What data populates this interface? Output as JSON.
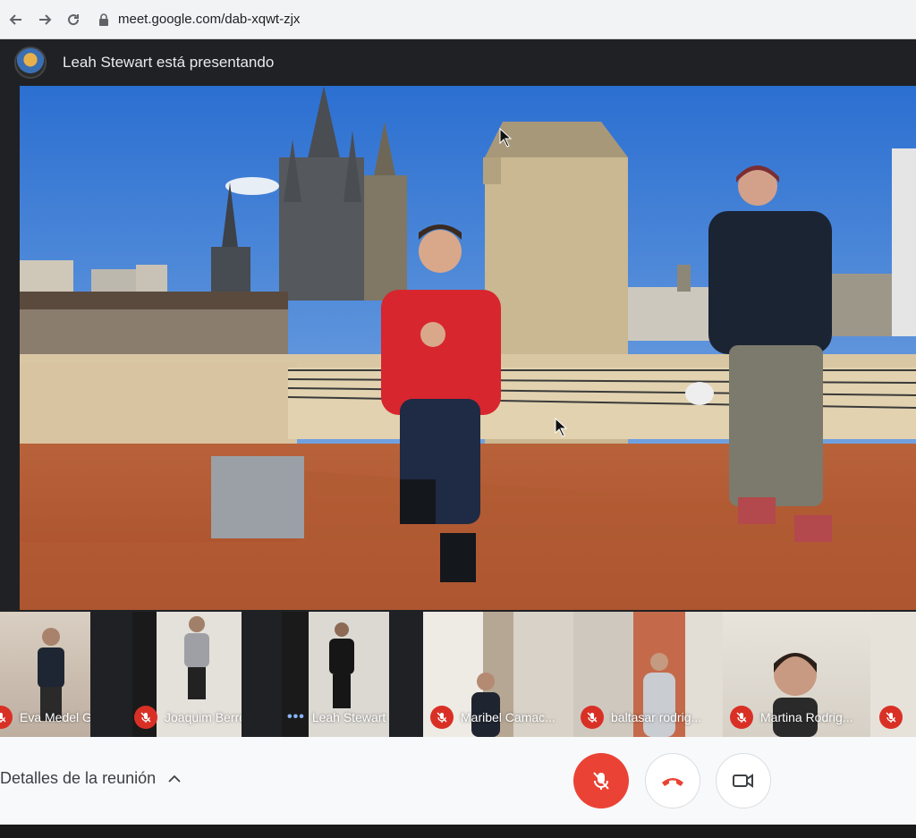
{
  "browser": {
    "url": "meet.google.com/dab-xqwt-zjx"
  },
  "meet": {
    "presenter_text": "Leah Stewart está presentando"
  },
  "participants": [
    {
      "name": "Eva Medel Gar...",
      "muted": true
    },
    {
      "name": "Joaquim Berro...",
      "muted": true
    },
    {
      "name": "Leah Stewart",
      "muted": false,
      "speaking": true
    },
    {
      "name": "Maribel Camac...",
      "muted": true
    },
    {
      "name": "baltasar rodrig...",
      "muted": true
    },
    {
      "name": "Martina Rodrig...",
      "muted": true
    }
  ],
  "bottom": {
    "details_label": "Detalles de la reunión"
  },
  "colors": {
    "mic_off_red": "#ea4335",
    "meet_dark": "#202124",
    "speaking_blue": "#8ab4f8"
  },
  "icons": [
    "back-arrow-icon",
    "forward-arrow-icon",
    "reload-icon",
    "lock-icon",
    "mic-off-icon",
    "hang-up-icon",
    "camera-icon",
    "chevron-up-icon",
    "more-dots-icon"
  ]
}
